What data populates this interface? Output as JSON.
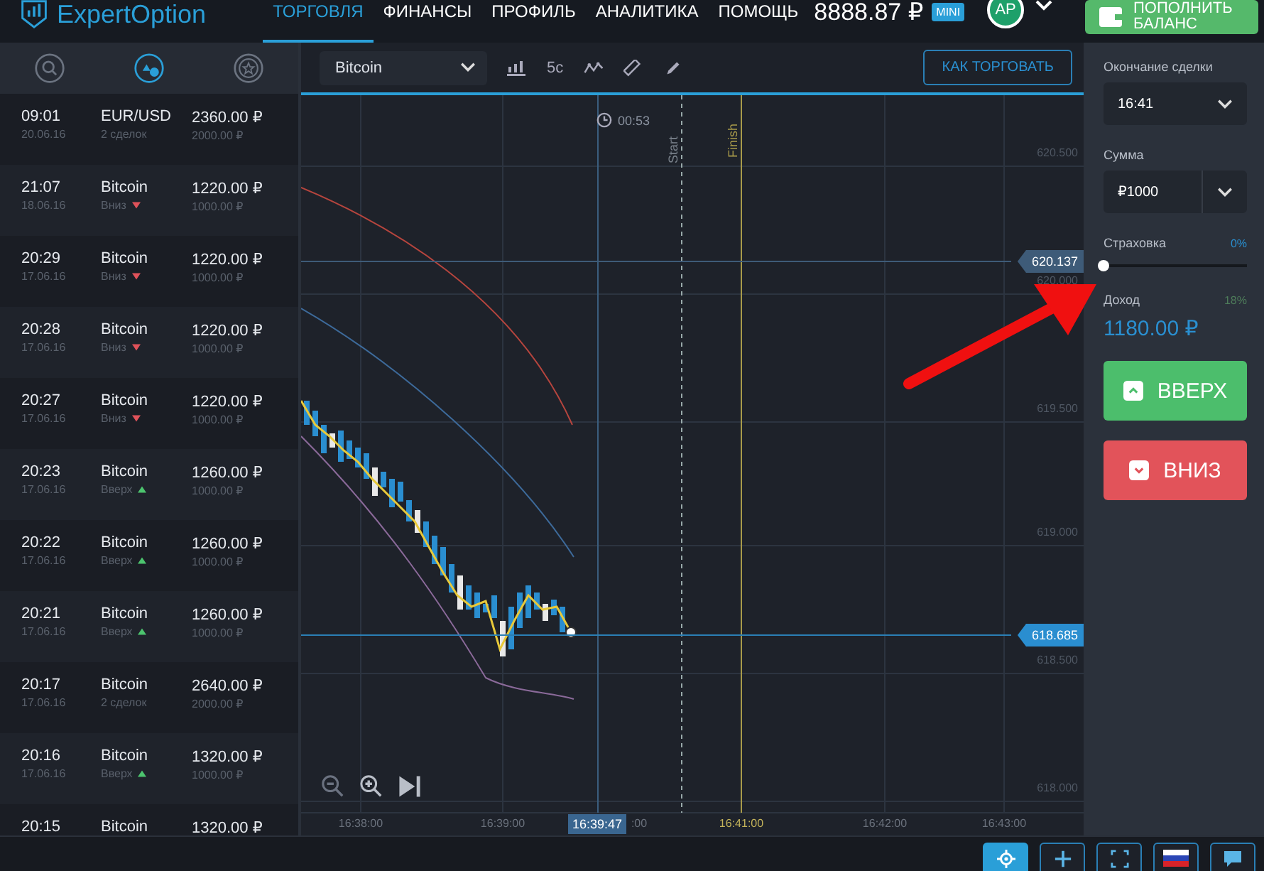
{
  "header": {
    "logo": "ExpertOption",
    "nav": [
      {
        "label": "ТОРГОВЛЯ",
        "selected": true
      },
      {
        "label": "ФИНАНСЫ",
        "selected": false
      },
      {
        "label": "ПРОФИЛЬ",
        "selected": false
      },
      {
        "label": "АНАЛИТИКА",
        "selected": false
      },
      {
        "label": "ПОМОЩЬ",
        "selected": false
      }
    ],
    "balance": "8888.87 ₽",
    "account_badge": "MINI",
    "avatar": "AP",
    "deposit_button": "ПОПОЛНИТЬ БАЛАНС"
  },
  "sidebar": {
    "tabs": [
      {
        "kind": "search",
        "selected": false
      },
      {
        "kind": "history",
        "selected": true
      },
      {
        "kind": "star",
        "selected": false
      }
    ],
    "trades": [
      {
        "time": "09:01",
        "date": "20.06.16",
        "asset": "EUR/USD",
        "detail": "2 сделок",
        "payout": "2360.00 ₽",
        "amount": "2000.00 ₽"
      },
      {
        "time": "21:07",
        "date": "18.06.16",
        "asset": "Bitcoin",
        "detail": "Вниз",
        "kind": "down",
        "payout": "1220.00 ₽",
        "amount": "1000.00 ₽"
      },
      {
        "time": "20:29",
        "date": "17.06.16",
        "asset": "Bitcoin",
        "detail": "Вниз",
        "kind": "down",
        "payout": "1220.00 ₽",
        "amount": "1000.00 ₽"
      },
      {
        "time": "20:28",
        "date": "17.06.16",
        "asset": "Bitcoin",
        "detail": "Вниз",
        "kind": "down",
        "payout": "1220.00 ₽",
        "amount": "1000.00 ₽"
      },
      {
        "time": "20:27",
        "date": "17.06.16",
        "asset": "Bitcoin",
        "detail": "Вниз",
        "kind": "down",
        "payout": "1220.00 ₽",
        "amount": "1000.00 ₽"
      },
      {
        "time": "20:23",
        "date": "17.06.16",
        "asset": "Bitcoin",
        "detail": "Вверх",
        "kind": "up",
        "payout": "1260.00 ₽",
        "amount": "1000.00 ₽"
      },
      {
        "time": "20:22",
        "date": "17.06.16",
        "asset": "Bitcoin",
        "detail": "Вверх",
        "kind": "up",
        "payout": "1260.00 ₽",
        "amount": "1000.00 ₽"
      },
      {
        "time": "20:21",
        "date": "17.06.16",
        "asset": "Bitcoin",
        "detail": "Вверх",
        "kind": "up",
        "payout": "1260.00 ₽",
        "amount": "1000.00 ₽"
      },
      {
        "time": "20:17",
        "date": "17.06.16",
        "asset": "Bitcoin",
        "detail": "2 сделок",
        "payout": "2640.00 ₽",
        "amount": "2000.00 ₽"
      },
      {
        "time": "20:16",
        "date": "17.06.16",
        "asset": "Bitcoin",
        "detail": "Вверх",
        "kind": "up",
        "payout": "1320.00 ₽",
        "amount": "1000.00 ₽"
      },
      {
        "time": "20:15",
        "asset": "Bitcoin",
        "payout": "1320.00 ₽"
      }
    ]
  },
  "toolbar": {
    "asset": "Bitcoin",
    "timeframe": "5с",
    "how_to_trade": "КАК ТОРГОВАТЬ"
  },
  "chart": {
    "timer": "00:53",
    "start_label": "Start",
    "finish_label": "Finish",
    "y_ticks": [
      "620.500",
      "620.000",
      "619.500",
      "619.000",
      "618.500",
      "618.000"
    ],
    "price_markers": [
      {
        "value": "620.137",
        "kind": "level"
      },
      {
        "value": "618.685",
        "kind": "current"
      }
    ],
    "x_ticks": [
      "16:38:00",
      "16:39:00",
      ":00",
      "16:41:00",
      "16:42:00",
      "16:43:00"
    ],
    "current_time": "16:39:47"
  },
  "trade_panel": {
    "expiry_label": "Окончание сделки",
    "expiry": "16:41",
    "amount_label": "Сумма",
    "amount": "₽1000",
    "insurance_label": "Страховка",
    "insurance_value": "0%",
    "insurance": {
      "level": 0
    },
    "income_label": "Доход",
    "income_percent": "18%",
    "income": "1180.00 ₽",
    "up_button": "ВВЕРХ",
    "down_button": "ВНИЗ"
  },
  "bottom_bar": [
    {
      "kind": "target",
      "selected": true
    },
    {
      "kind": "plus",
      "selected": false
    },
    {
      "kind": "fullscreen",
      "selected": false
    },
    {
      "kind": "flag",
      "selected": false
    },
    {
      "kind": "chat",
      "selected": false
    }
  ]
}
